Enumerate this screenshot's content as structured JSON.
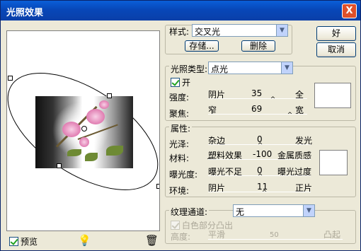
{
  "window": {
    "title": "光照效果",
    "close_label": "X"
  },
  "preview": {
    "label": "预览",
    "checked": true,
    "bulb_icon": "light-bulb-icon",
    "trash_icon": "trash-icon"
  },
  "style": {
    "label": "样式:",
    "value": "交叉光",
    "save_button": "存储...",
    "delete_button": "删除"
  },
  "buttons": {
    "ok": "好",
    "cancel": "取消"
  },
  "light_type": {
    "label": "光照类型:",
    "value": "点光",
    "on_label": "开",
    "on_checked": true,
    "intensity": {
      "label": "强度:",
      "min": "阴片",
      "max": "全",
      "value": "35"
    },
    "focus": {
      "label": "聚焦:",
      "min": "窄",
      "max": "宽",
      "value": "69"
    },
    "color": "#ffffff"
  },
  "properties": {
    "label": "属性:",
    "gloss": {
      "label": "光泽:",
      "min": "杂边",
      "max": "发光",
      "value": "0"
    },
    "material": {
      "label": "材料:",
      "min": "塑料效果",
      "max": "金属质感",
      "value": "-100"
    },
    "exposure": {
      "label": "曝光度:",
      "min": "曝光不足",
      "max": "曝光过度",
      "value": "0"
    },
    "ambience": {
      "label": "环境:",
      "min": "阴片",
      "max": "正片",
      "value": "11"
    },
    "color": "#ffffff"
  },
  "texture": {
    "label": "纹理通道:",
    "value": "无",
    "white_high_label": "白色部分凸出",
    "white_high_checked": true,
    "height": {
      "label": "高度:",
      "min": "平滑",
      "max": "凸起",
      "value": "50"
    }
  }
}
